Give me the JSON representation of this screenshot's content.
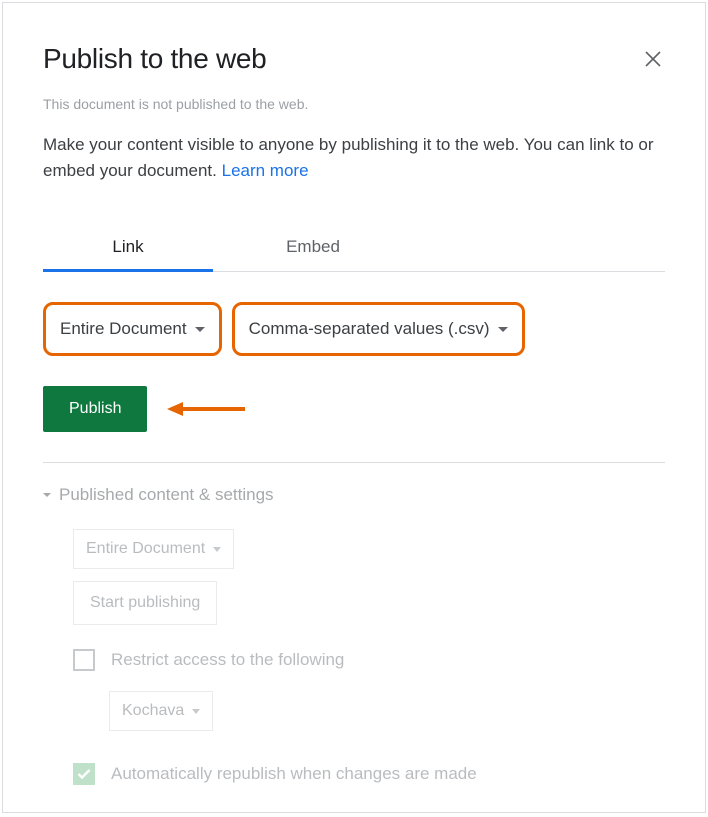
{
  "dialog": {
    "title": "Publish to the web",
    "status": "This document is not published to the web.",
    "description": "Make your content visible to anyone by publishing it to the web. You can link to or embed your document. ",
    "learn_more": "Learn more"
  },
  "tabs": {
    "link": "Link",
    "embed": "Embed"
  },
  "dropdowns": {
    "scope": "Entire Document",
    "format": "Comma-separated values (.csv)"
  },
  "buttons": {
    "publish": "Publish"
  },
  "settings": {
    "header": "Published content & settings",
    "scope": "Entire Document",
    "start_publishing": "Start publishing",
    "restrict_access": "Restrict access to the following",
    "restrict_target": "Kochava",
    "auto_republish": "Automatically republish when changes are made"
  }
}
